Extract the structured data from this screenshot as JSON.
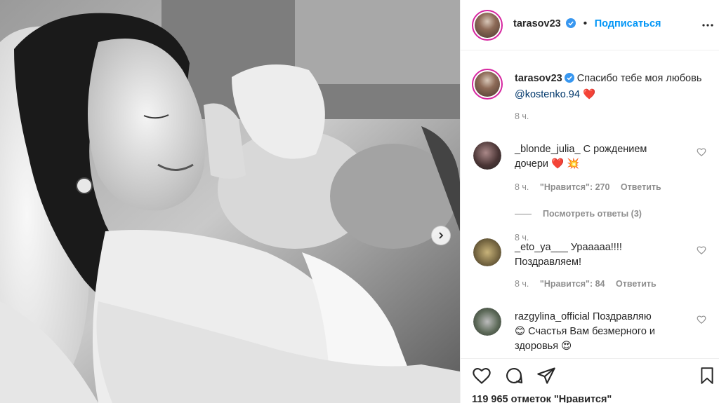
{
  "post": {
    "author": "tarasov23",
    "follow_label": "Подписаться",
    "dot": "•",
    "caption": {
      "username": "tarasov23",
      "text": "Спасибо тебе моя любовь",
      "mention": "@kostenko.94",
      "emoji": "❤️",
      "time": "8 ч."
    }
  },
  "comments": [
    {
      "username": "_blonde_julia_",
      "text": "С рождением дочери",
      "emoji": "❤️ 💥",
      "time": "8 ч.",
      "likes_label": "\"Нравится\": 270",
      "reply_label": "Ответить",
      "view_replies": "Посмотреть ответы (3)"
    },
    {
      "username": "_eto_ya___",
      "text": "Урааааа!!!! Поздравляем!",
      "time": "8 ч.",
      "likes_label": "\"Нравится\": 84",
      "reply_label": "Ответить"
    },
    {
      "username": "razgylina_official",
      "text_1": "Поздравляю",
      "text_2": "Счастья Вам безмерного и",
      "text_3": "здоровья",
      "emoji_1": "😊",
      "emoji_2": "😍"
    }
  ],
  "footer": {
    "likes_text": "119 965 отметок \"Нравится\""
  },
  "icons": {
    "verified": "verified-badge-icon",
    "heart": "heart-icon",
    "comment": "comment-icon",
    "share": "share-icon",
    "save": "bookmark-icon",
    "next": "chevron-right-icon"
  },
  "colors": {
    "link": "#0095f6",
    "mention": "#00376b",
    "muted": "#8e8e8e",
    "heart": "#ed4956"
  }
}
